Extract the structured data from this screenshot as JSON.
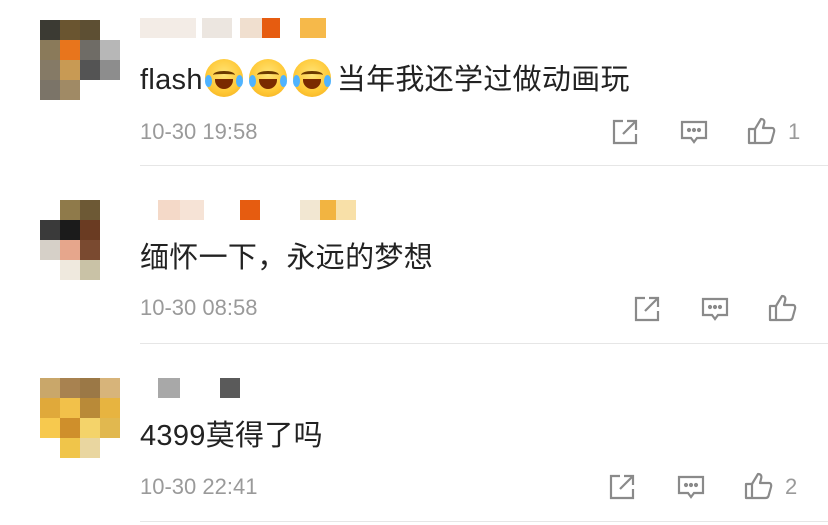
{
  "comments": [
    {
      "text": "flash",
      "text_after_emoji": "当年我还学过做动画玩",
      "emoji": [
        "laugh-cry-emoji",
        "laugh-cry-emoji",
        "laugh-cry-emoji"
      ],
      "time": "10-30 19:58",
      "likes": "1"
    },
    {
      "text": "缅怀一下，永远的梦想",
      "time": "10-30 08:58",
      "likes": ""
    },
    {
      "text": "4399莫得了吗",
      "time": "10-30 22:41",
      "likes": "2"
    }
  ],
  "icons": {
    "share": "share-icon",
    "reply": "comment-icon",
    "like": "thumbs-up-icon"
  },
  "colors": {
    "text": "#222222",
    "meta": "#9a9a9a",
    "icon": "#8a8a8a",
    "divider": "#e6e6e6"
  }
}
